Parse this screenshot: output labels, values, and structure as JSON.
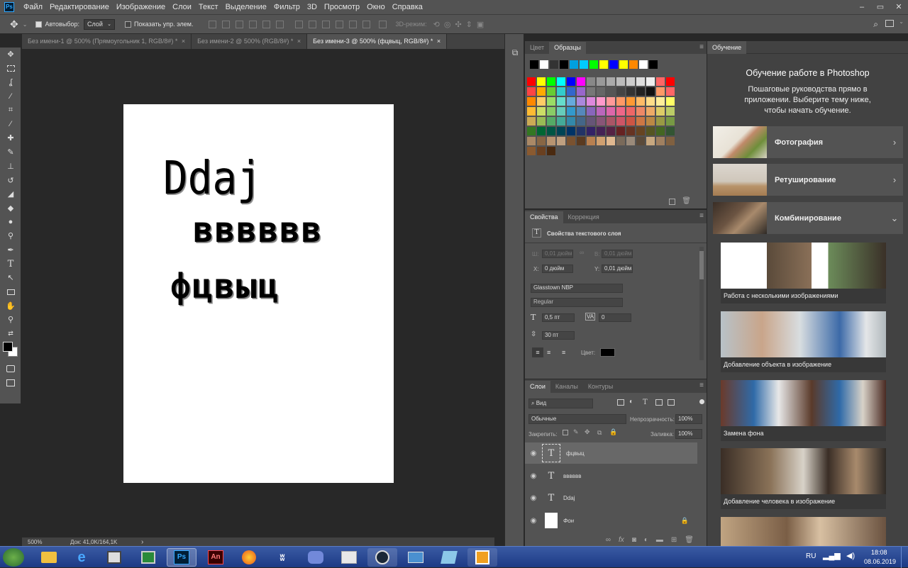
{
  "menu": {
    "items": [
      "Файл",
      "Редактирование",
      "Изображение",
      "Слои",
      "Текст",
      "Выделение",
      "Фильтр",
      "3D",
      "Просмотр",
      "Окно",
      "Справка"
    ],
    "app_icon": "Ps"
  },
  "window_controls": [
    "–",
    "▭",
    "✕"
  ],
  "options": {
    "auto_select_label": "Автовыбор:",
    "layer_select": "Слой",
    "show_controls_label": "Показать упр. элем.",
    "mode_3d_label": "3D-режим:"
  },
  "tabs": [
    {
      "label": "Без имени-1 @ 500% (Прямоугольник 1, RGB/8#) *",
      "active": false
    },
    {
      "label": "Без имени-2 @ 500% (RGB/8#) *",
      "active": false
    },
    {
      "label": "Без имени-3 @ 500% (фцвыц, RGB/8#) *",
      "active": true
    }
  ],
  "tab_close": "×",
  "canvas": {
    "text_1": "Ddaj",
    "text_2": "вввввв",
    "text_3": "фцвыц"
  },
  "status": {
    "zoom": "500%",
    "doc": "Док: 41,0K/164,1K",
    "arrow": "›"
  },
  "swatches_panel": {
    "tab_color": "Цвет",
    "tab_swatches": "Образцы",
    "menu": "≡"
  },
  "properties_panel": {
    "tab_properties": "Свойства",
    "tab_correction": "Коррекция",
    "header": "Свойства текстового слоя",
    "w_label": "Ш:",
    "w_value": "0,01 дюйм",
    "h_label": "В:",
    "h_value": "0,01 дюйм",
    "x_label": "X:",
    "x_value": "0 дюйм",
    "y_label": "Y:",
    "y_value": "0,01 дюйм",
    "font": "Glasstown NBP",
    "style": "Regular",
    "size": "0,5 пт",
    "tracking": "0",
    "leading": "30 пт",
    "color_label": "Цвет:"
  },
  "layers_panel": {
    "tab_layers": "Слои",
    "tab_channels": "Каналы",
    "tab_paths": "Контуры",
    "filter": "Вид",
    "blend_mode": "Обычные",
    "opacity_label": "Непрозрачность:",
    "opacity": "100%",
    "lock_label": "Закрепить:",
    "fill_label": "Заливка:",
    "fill": "100%",
    "layers": [
      {
        "name": "фцвыц",
        "type": "text",
        "selected": true
      },
      {
        "name": "вввввв",
        "type": "text",
        "selected": false
      },
      {
        "name": "Ddaj",
        "type": "text",
        "selected": false
      },
      {
        "name": "Фон",
        "type": "background",
        "selected": false
      }
    ]
  },
  "learn_panel": {
    "tab": "Обучение",
    "title": "Обучение работе в Photoshop",
    "subtitle": "Пошаговые руководства прямо в приложении. Выберите тему ниже, чтобы начать обучение.",
    "categories": [
      {
        "label": "Фотография",
        "chevron": "›"
      },
      {
        "label": "Ретуширование",
        "chevron": "›"
      },
      {
        "label": "Комбинирование",
        "chevron": "⌄"
      }
    ],
    "tutorials": [
      "Работа с несколькими изображениями",
      "Добавление объекта в изображение",
      "Замена фона",
      "Добавление человека в изображение"
    ]
  },
  "taskbar": {
    "lang": "RU",
    "time": "18:08",
    "date": "08.06.2019",
    "apps": [
      "explorer",
      "ie",
      "media",
      "task-manager",
      "photoshop",
      "animate",
      "firefox",
      "winamp",
      "discord",
      "paint",
      "steam",
      "image-viewer",
      "notepad",
      "sticky"
    ]
  },
  "colors": {
    "accent": "#31a8ff",
    "panel": "#535353",
    "dark": "#424242",
    "canvas_bg": "#282828"
  }
}
